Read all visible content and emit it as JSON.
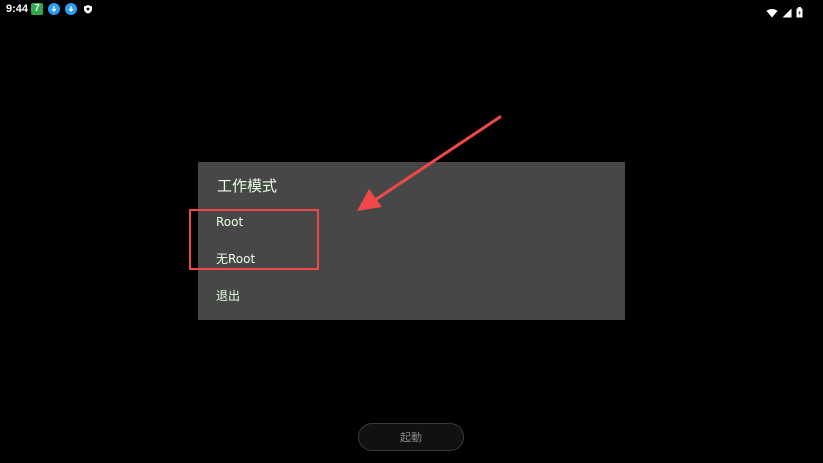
{
  "status_bar": {
    "time": "9:44",
    "notifications": [
      {
        "icon": "seven-app-icon",
        "label": "7",
        "color": "#2eaa4a"
      },
      {
        "icon": "download-icon",
        "color": "#2a9df4"
      },
      {
        "icon": "download-icon",
        "color": "#2a9df4"
      },
      {
        "icon": "shield-icon",
        "color": "#ffffff"
      }
    ],
    "system_icons": [
      "wifi-icon",
      "signal-icon",
      "battery-icon"
    ]
  },
  "dialog": {
    "title": "工作模式",
    "options": [
      {
        "label": "Root"
      },
      {
        "label": "无Root"
      },
      {
        "label": "退出"
      }
    ]
  },
  "annotation": {
    "color": "#f04848"
  },
  "start_button": {
    "label": "起動"
  }
}
